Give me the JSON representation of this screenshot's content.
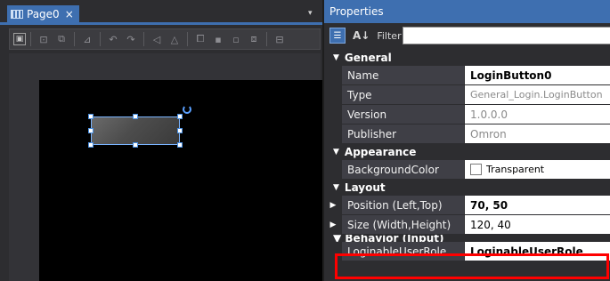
{
  "designer": {
    "tab_label": "Page0",
    "tab_close": "×",
    "tab_dropdown": "▾",
    "toolbar_first": "▣"
  },
  "properties": {
    "header_title": "Properties",
    "sort_icon_label": "A↓",
    "filter_label": "Filter",
    "filter_value": "",
    "categories": {
      "general": "General",
      "appearance": "Appearance",
      "layout": "Layout",
      "behavior": "Behavior (Input)"
    },
    "rows": {
      "name": {
        "label": "Name",
        "value": "LoginButton0"
      },
      "type": {
        "label": "Type",
        "value": "General_Login.LoginButton"
      },
      "version": {
        "label": "Version",
        "value": "1.0.0.0"
      },
      "publisher": {
        "label": "Publisher",
        "value": "Omron"
      },
      "background_color": {
        "label": "BackgroundColor",
        "value": "Transparent"
      },
      "position": {
        "label": "Position (Left,Top)",
        "value": "70, 50"
      },
      "size": {
        "label": "Size (Width,Height)",
        "value": "120, 40"
      },
      "loginable_user_role": {
        "label": "LoginableUserRole",
        "value": "LoginableUserRole"
      }
    }
  },
  "colors": {
    "accent": "#3e6fb0",
    "highlight": "#ff0000",
    "selection": "#7ab4ff"
  }
}
